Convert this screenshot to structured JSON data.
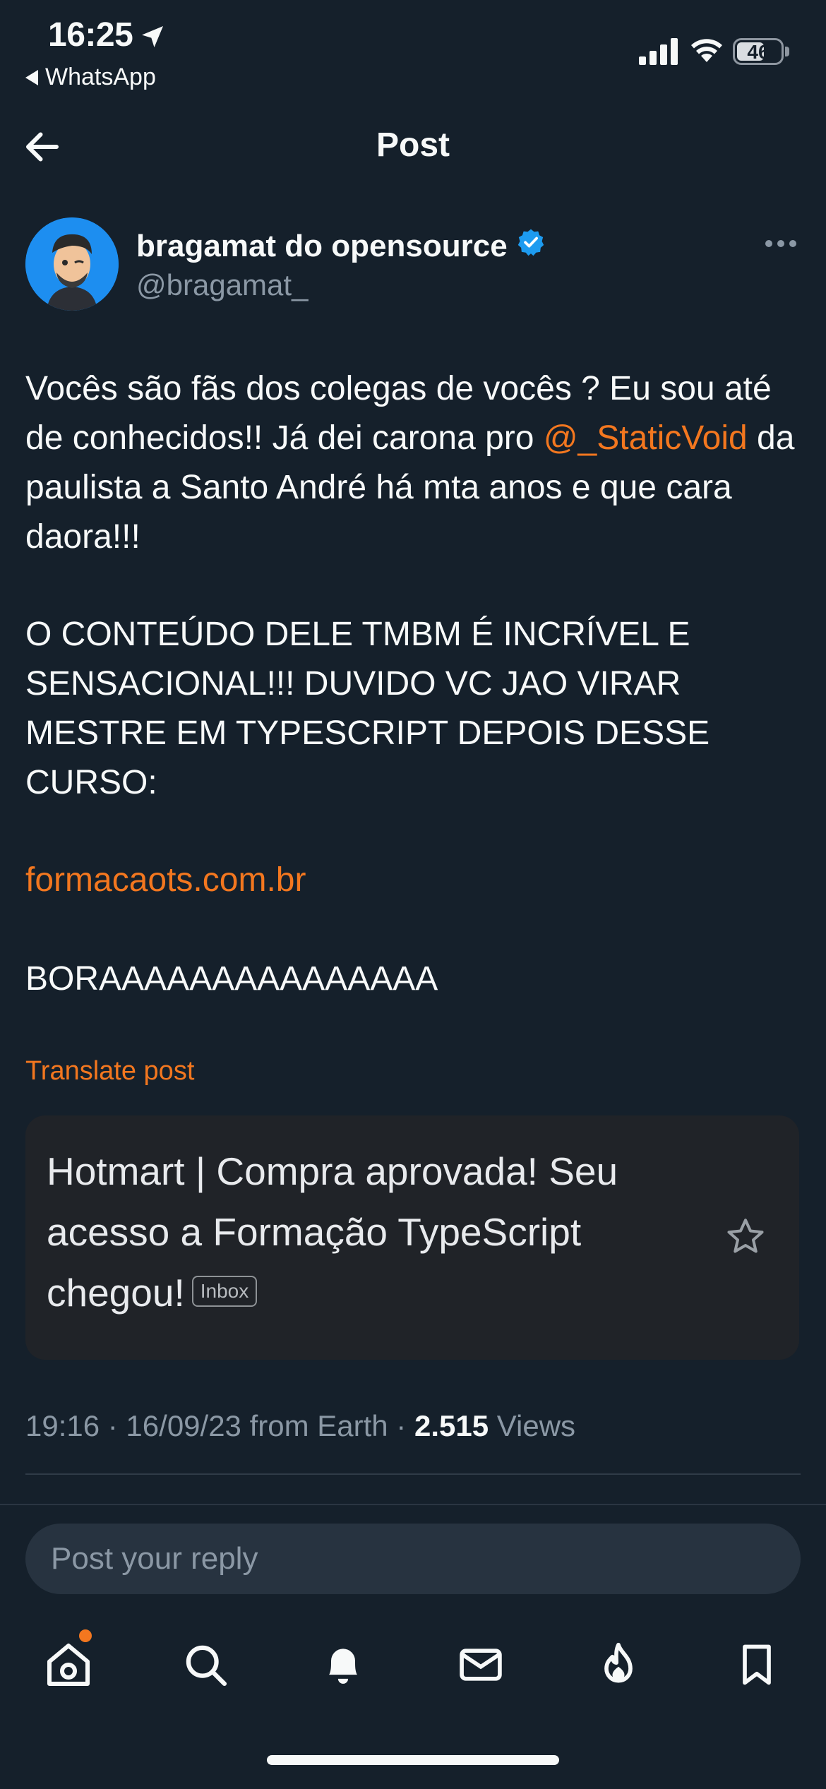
{
  "status_bar": {
    "time": "16:25",
    "back_app": "WhatsApp",
    "battery": "46"
  },
  "header": {
    "title": "Post"
  },
  "author": {
    "name": "bragamat do opensource",
    "handle": "@bragamat_",
    "verified": true
  },
  "post": {
    "p1_before": "Vocês são fãs dos colegas de vocês ? Eu sou até de conhecidos!! Já dei carona pro ",
    "mention": "@_StaticVoid",
    "p1_after": " da paulista a Santo André há mta anos e que cara daora!!!",
    "p2": "O CONTEÚDO DELE TMBM É INCRÍVEL E SENSACIONAL!!! DUVIDO VC JAO VIRAR MESTRE EM TYPESCRIPT DEPOIS DESSE CURSO:",
    "link": "formacaots.com.br",
    "p4": "BORAAAAAAAAAAAAAAA",
    "translate": "Translate post"
  },
  "card": {
    "title": "Hotmart | Compra aprovada! Seu acesso a Formação TypeScript chegou!",
    "badge": "Inbox"
  },
  "meta": {
    "datetime": "19:16 · 16/09/23 from Earth · ",
    "views_count": "2.515",
    "views_label": " Views"
  },
  "reply": {
    "placeholder": "Post your reply"
  },
  "tabbar": {
    "items": [
      "home-icon",
      "search-icon",
      "bell-icon",
      "mail-icon",
      "flame-icon",
      "bookmark-icon"
    ]
  },
  "colors": {
    "background": "#15202b",
    "accent": "#f3771f",
    "verified": "#1d9bf0"
  }
}
